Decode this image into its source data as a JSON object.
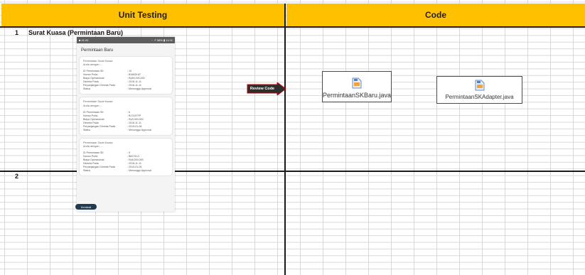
{
  "headers": {
    "left": "Unit Testing",
    "right": "Code"
  },
  "rows": [
    {
      "number": "1",
      "title": "Surat Kuasa (Permintaan Baru)"
    },
    {
      "number": "2"
    }
  ],
  "phone": {
    "status_left": "■ 41 61",
    "status_right": "·· ↗ 58% ▮ 14:11",
    "app_title": "Permintaan Baru",
    "cards": [
      {
        "line1": "Permintaan Surat Kuasa",
        "line2": "Anda dengan ...",
        "rows": [
          {
            "k": "ID Permintaan SK",
            "v": ": 10"
          },
          {
            "k": "Nomor Polisi",
            "v": ": B1662KAT"
          },
          {
            "k": "Biaya Operasional",
            "v": ": Rp50,000,000"
          },
          {
            "k": "Diminta Pada",
            "v": ": 2018-11-11"
          },
          {
            "k": "Perpanjangan Diminta Pada",
            "v": ": 2018-11-11"
          },
          {
            "k": "Status",
            "v": ": Menunggu Approval"
          }
        ]
      },
      {
        "line1": "Permintaan Surat Kuasa",
        "line2": "Anda dengan ...",
        "rows": [
          {
            "k": "ID Permintaan SK",
            "v": ": 6"
          },
          {
            "k": "Nomor Polisi",
            "v": ": B1744TFP"
          },
          {
            "k": "Biaya Operasional",
            "v": ": Rp3,000,000"
          },
          {
            "k": "Diminta Pada",
            "v": ": 2018-11-11"
          },
          {
            "k": "Perpanjangan Diminta Pada",
            "v": ": 2019-01-08"
          },
          {
            "k": "Status",
            "v": ": Menunggu Approval"
          }
        ]
      },
      {
        "line1": "Permintaan Surat Kuasa",
        "line2": "Anda dengan ...",
        "rows": [
          {
            "k": "ID Permintaan SK",
            "v": ": 5"
          },
          {
            "k": "Nomor Polisi",
            "v": ": B8272LG"
          },
          {
            "k": "Biaya Operasional",
            "v": ": Rp6,000,000"
          },
          {
            "k": "Diminta Pada",
            "v": ": 2018-11-11"
          },
          {
            "k": "Perpanjangan Diminta Pada",
            "v": ": 2019-01-05"
          },
          {
            "k": "Status",
            "v": ": Menunggu Approval"
          }
        ]
      }
    ],
    "back_button": "Kembali"
  },
  "review_label": "Review Code",
  "files": [
    {
      "name": "PermintaanSKBaru.java",
      "icon": "java-file-icon"
    },
    {
      "name": "PermintaanSKAdapter.java",
      "icon": "java-file-icon"
    }
  ],
  "colors": {
    "header": "#ffc000",
    "arrow": "#2e2e2e",
    "arrow_border": "#c00000",
    "button": "#1f3b4d"
  }
}
